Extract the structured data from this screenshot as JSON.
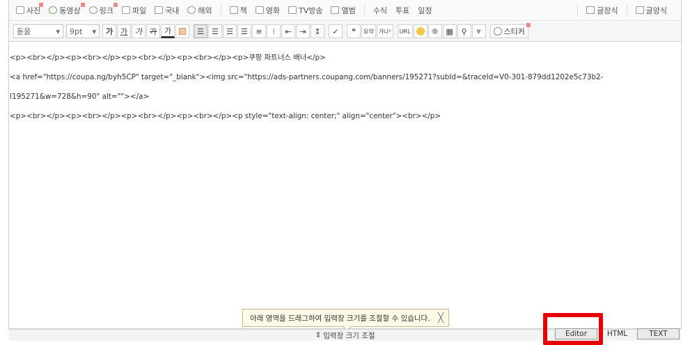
{
  "toolbar_top": {
    "items": [
      {
        "label": "사진",
        "icon": "photo-icon"
      },
      {
        "label": "동영상",
        "icon": "video-icon"
      },
      {
        "label": "링크",
        "icon": "link-icon"
      },
      {
        "label": "파일",
        "icon": "file-icon"
      },
      {
        "label": "국내",
        "icon": "map-icon"
      },
      {
        "label": "해외",
        "icon": "globe-icon"
      },
      {
        "label": "책",
        "icon": "book-icon"
      },
      {
        "label": "영화",
        "icon": "movie-icon"
      },
      {
        "label": "TV방송",
        "icon": "tv-icon"
      },
      {
        "label": "앨범",
        "icon": "album-icon"
      },
      {
        "label": "수식"
      },
      {
        "label": "투표"
      },
      {
        "label": "일정"
      },
      {
        "label": "글장식",
        "icon": "decorate-icon"
      },
      {
        "label": "글양식",
        "icon": "template-icon"
      }
    ]
  },
  "toolbar_format": {
    "font": "돋움",
    "size": "9pt",
    "style_buttons": [
      "가",
      "가",
      "가",
      "가",
      "가"
    ],
    "quote": "❝",
    "summary": "요약",
    "extra": "가나²",
    "url": "URL",
    "sticker": "스티커"
  },
  "editor": {
    "line1": "<p><br></p><p><br></p><p><br></p><p><br></p><p>쿠팡 파트너스 배너</p>",
    "line2": "<a href=\"https://coupa.ng/byh5CP\" target=\"_blank\"><img src=\"https://ads-partners.coupang.com/banners/195271?subId=&traceId=V0-301-879dd1202e5c73b2-",
    "line3": "I195271&w=728&h=90\" alt=\"\"></a>",
    "line4": "<p><br></p><p><br></p><p><br></p><p><br></p><p style=\"text-align: center;\" align=\"center\"><br></p>"
  },
  "tooltip": {
    "text": "아래 영역을 드래그하여 입력창 크기를 조절할 수 있습니다.",
    "close": "╳"
  },
  "resize_bar": {
    "label": "입력창 크기 조절",
    "icon": "⇕"
  },
  "mode_tabs": {
    "editor": "Editor",
    "html": "HTML",
    "text": "TEXT"
  }
}
